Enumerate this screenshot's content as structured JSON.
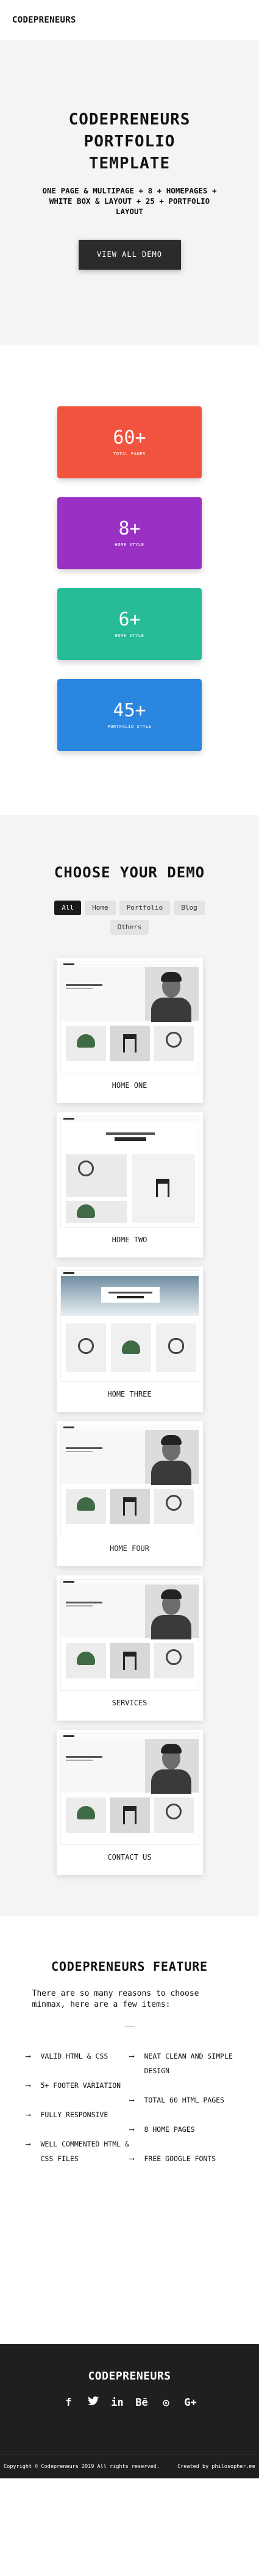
{
  "header": {
    "brand": "CODEPRENEURS"
  },
  "hero": {
    "title_line1": "CODEPRENEURS",
    "title_line2": "PORTFOLIO",
    "title_line3": "TEMPLATE",
    "subtitle": "ONE PAGE & MULTIPAGE + 8 + HOMEPAGES + WHITE BOX & LAYOUT + 25 + PORTFOLIO LAYOUT",
    "button_label": "VIEW ALL DEMO"
  },
  "stats": [
    {
      "number": "60+",
      "label": "TOTAL PAGES",
      "color": "#f1533f"
    },
    {
      "number": "8+",
      "label": "HOME STYLE",
      "color": "#9b30c4"
    },
    {
      "number": "6+",
      "label": "HOME STYLE",
      "color": "#27bc97"
    },
    {
      "number": "45+",
      "label": "PORTFOLIO STYLE",
      "color": "#2b86e0"
    }
  ],
  "demos": {
    "title": "CHOOSE YOUR DEMO",
    "filters": [
      "All",
      "Home",
      "Portfolio",
      "Blog",
      "Others"
    ],
    "cards": [
      "HOME ONE",
      "HOME TWO",
      "HOME THREE",
      "HOME FOUR",
      "SERVICES",
      "CONTACT US"
    ]
  },
  "features": {
    "title": "CODEPRENEURS FEATURE",
    "intro": "There are so many reasons to choose minmax, here are a few items:",
    "left": [
      "VALID HTML & CSS",
      "5+ FOOTER VARIATION",
      "FULLY RESPONSIVE",
      "WELL COMMENTED HTML & CSS FILES"
    ],
    "right": [
      "NEAT CLEAN AND SIMPLE DESIGN",
      "TOTAL 60 HTML PAGES",
      "8 HOME PAGES",
      "FREE GOOGLE FONTS"
    ],
    "arrow": "⟶"
  },
  "footer": {
    "brand": "CODEPRENEURS",
    "socials": [
      {
        "icon": "facebook-icon",
        "glyph": "f"
      },
      {
        "icon": "twitter-icon",
        "glyph": "🐦"
      },
      {
        "icon": "linkedin-icon",
        "glyph": "in"
      },
      {
        "icon": "behance-icon",
        "glyph": "Bē"
      },
      {
        "icon": "dribbble-icon",
        "glyph": "◎"
      },
      {
        "icon": "google-plus-icon",
        "glyph": "G+"
      }
    ],
    "copyright": "Copyright © Codepreneurs 2019 All rights reserved.",
    "credit": "Created by philosopher.me"
  }
}
